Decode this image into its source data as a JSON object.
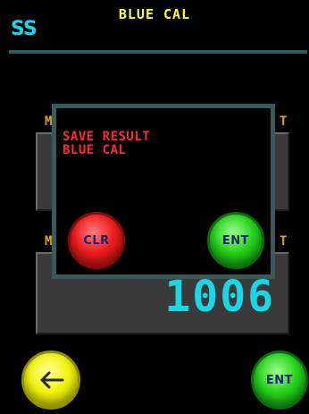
{
  "header": {
    "logo": "SS",
    "title": "BLUE CAL"
  },
  "background": {
    "label_left_1": "M",
    "label_right_1": "T",
    "label_left_2": "M",
    "label_right_2": "T",
    "value_display": "1006"
  },
  "dialog": {
    "line1": "SAVE RESULT",
    "line2": "BLUE CAL",
    "clear_label": "CLR",
    "enter_label": "ENT"
  },
  "footer": {
    "back_icon": "arrow-left-icon",
    "enter_label": "ENT"
  },
  "colors": {
    "title": "#ffff33",
    "logo": "#19d7e4",
    "dialog_text": "#ff2a2a",
    "dialog_border": "#3a5a5a",
    "value_display": "#19d7e4"
  }
}
